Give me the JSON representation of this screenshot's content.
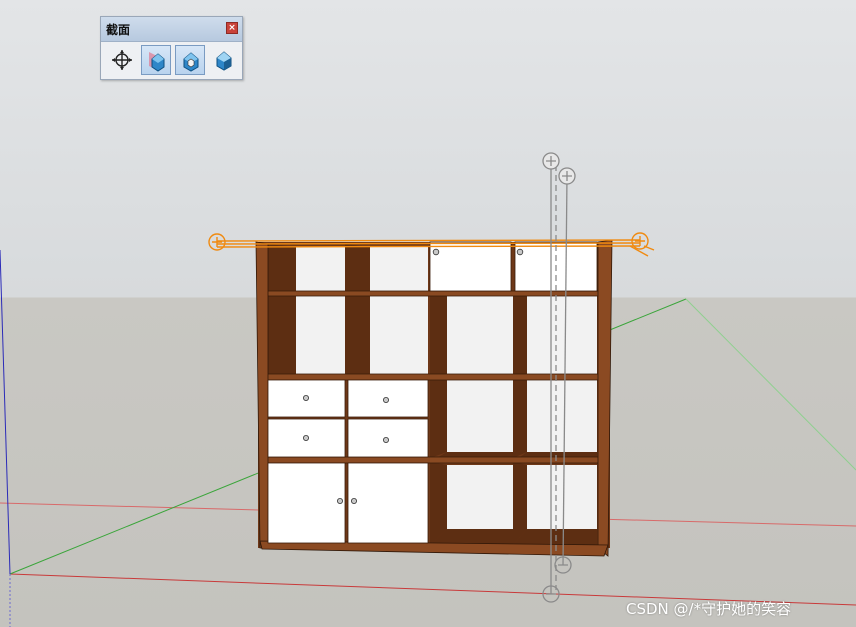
{
  "toolbar": {
    "title": "截面",
    "close_label": "×",
    "buttons": [
      {
        "name": "section-plane",
        "icon": "section-plane-icon",
        "active": false
      },
      {
        "name": "display-section-planes",
        "icon": "display-section-planes-icon",
        "active": true
      },
      {
        "name": "display-section-cuts",
        "icon": "display-section-cuts-icon",
        "active": true
      },
      {
        "name": "display-section-fill",
        "icon": "display-section-fill-icon",
        "active": false
      }
    ]
  },
  "colors": {
    "wood": "#7a3f1c",
    "panel": "#ffffff",
    "section_orange": "#f08a10",
    "section_gray": "#8a8a8a",
    "axis_red": "#d24040",
    "axis_green": "#2e9b2e",
    "axis_blue": "#2b2bb8",
    "sky": "#dfe1e3",
    "ground": "#c5c4bf"
  },
  "watermark": "CSDN @/*守护她的笑容"
}
